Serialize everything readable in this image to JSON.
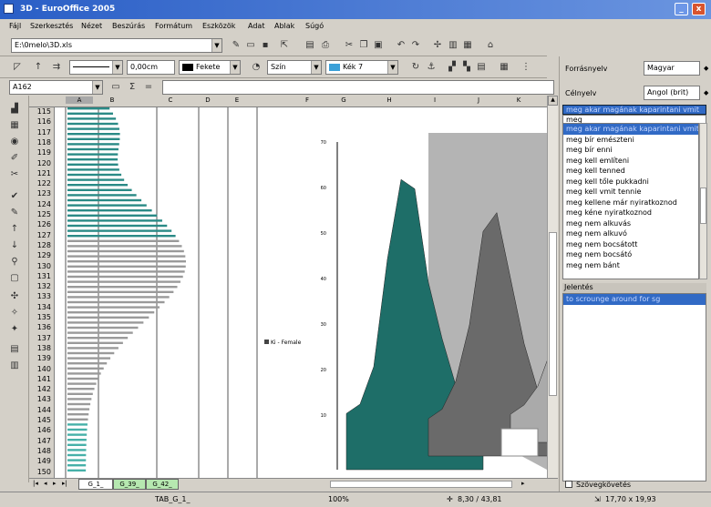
{
  "window": {
    "title": "3D - EuroOffice 2005",
    "minimize": "_",
    "close": "x"
  },
  "menu": [
    "Fájl",
    "Szerkesztés",
    "Nézet",
    "Beszúrás",
    "Formátum",
    "Eszközök",
    "Adat",
    "Ablak",
    "Súgó"
  ],
  "toolbar": {
    "filepath": "E:\\0melo\\3D.xls",
    "line_width": "0,00cm",
    "line_color": "Fekete",
    "area_style": "Szín",
    "area_color": "Kék 7"
  },
  "formula": {
    "cell_ref": "A162",
    "sum_icon": "Σ",
    "equals_icon": "=",
    "value": ""
  },
  "sheet": {
    "columns": [
      "A",
      "B",
      "C",
      "D",
      "E",
      "F",
      "G",
      "H",
      "I",
      "J",
      "K"
    ],
    "rows": [
      "115",
      "116",
      "117",
      "118",
      "119",
      "120",
      "121",
      "122",
      "123",
      "124",
      "125",
      "126",
      "127",
      "128",
      "129",
      "130",
      "131",
      "132",
      "133",
      "134",
      "135",
      "136",
      "137",
      "138",
      "139",
      "140",
      "141",
      "142",
      "143",
      "144",
      "145",
      "146",
      "147",
      "148",
      "149",
      "150"
    ],
    "tabs": [
      "G_1_",
      "G_39_",
      "G_42_"
    ],
    "legend_label": "Ki - Female"
  },
  "chart_data": {
    "type": "area",
    "title": "",
    "ylabel": "",
    "yticks": [
      "10",
      "20",
      "30",
      "40",
      "50",
      "60",
      "70"
    ],
    "series": [
      {
        "color": "#1e6e68",
        "values": [
          12,
          14,
          22,
          45,
          62,
          60,
          40,
          28,
          18,
          12,
          8
        ]
      },
      {
        "color": "#6a6a6a",
        "values": [
          8,
          10,
          16,
          28,
          48,
          52,
          38,
          24,
          14,
          10,
          6
        ]
      },
      {
        "color": "#aaaaaa",
        "values": [
          6,
          8,
          12,
          20,
          34,
          36,
          28,
          18,
          10,
          8,
          5
        ]
      }
    ]
  },
  "dictionary": {
    "source_lang_label": "Forrásnyelv",
    "source_lang": "Magyar",
    "target_lang_label": "Célnyelv",
    "target_lang": "Angol (brit)",
    "highlighted_phrase": "meg akar magának kaparintani vmit",
    "search_value": "meg",
    "words": [
      "meg akar magának kaparintani vmit",
      "meg bír emészteni",
      "meg bír enni",
      "meg kell említeni",
      "meg kell tenned",
      "meg kell tőle pukkadni",
      "meg kell vmit tennie",
      "meg kellene már nyiratkoznod",
      "meg kéne nyiratkoznod",
      "meg nem alkuvás",
      "meg nem alkuvó",
      "meg nem bocsátott",
      "meg nem bocsátó",
      "meg nem bánt"
    ],
    "meaning_label": "Jelentés",
    "meaning": "to scrounge around for sg",
    "text_follow_label": "Szövegkövetés"
  },
  "status": {
    "sheet_name": "TAB_G_1_",
    "zoom": "100%",
    "position": "8,30 / 43,81",
    "size": "17,70 x 19,93"
  }
}
